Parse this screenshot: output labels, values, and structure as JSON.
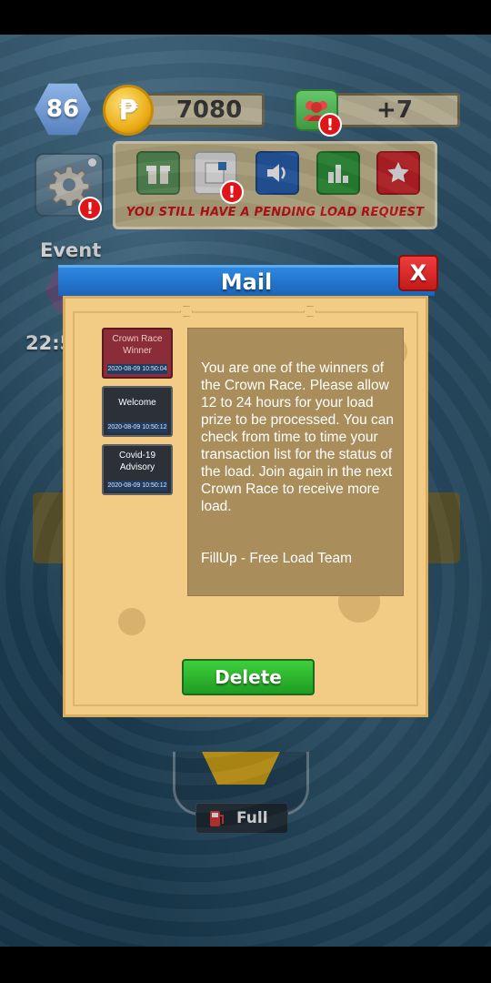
{
  "hud": {
    "level": "86",
    "coin_symbol": "₱",
    "coins": "7080",
    "friends_count": "+7",
    "alert_mark": "!"
  },
  "toolbar": {
    "buttons": [
      "gift-icon",
      "load-request-icon",
      "sound-icon",
      "leaderboard-icon",
      "favorites-icon"
    ],
    "pending_text": "YOU STILL HAVE A PENDING LOAD REQUEST"
  },
  "event": {
    "label": "Event",
    "timer": "22:5"
  },
  "fuel": {
    "label": "Full"
  },
  "mail": {
    "title": "Mail",
    "close_label": "X",
    "items": [
      {
        "title": "Crown Race Winner",
        "date": "2020-08-09 10:50:04",
        "selected": true
      },
      {
        "title": "Welcome",
        "date": "2020-08-09 10:50:12",
        "selected": false
      },
      {
        "title": "Covid-19 Advisory",
        "date": "2020-08-09 10:50:12",
        "selected": false
      }
    ],
    "message": {
      "body": "You are one of the winners of the Crown Race. Please allow 12 to 24 hours for your load prize to be processed. You can check from time to time your transaction list for the status of the load. Join again in the next Crown Race to receive more load.",
      "signature": "FillUp - Free Load Team"
    },
    "delete_label": "Delete"
  },
  "colors": {
    "header_blue": "#1a64bb",
    "close_red": "#c41b1b",
    "delete_green": "#1f9c22",
    "panel_tan": "#f2cc84",
    "pending_red": "#d8141b"
  }
}
